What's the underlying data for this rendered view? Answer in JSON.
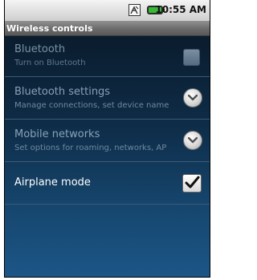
{
  "status_bar": {
    "time": "10:55 AM",
    "icons": [
      "network-icon",
      "battery-icon"
    ]
  },
  "header": {
    "title": "Wireless controls"
  },
  "settings": [
    {
      "title": "Bluetooth",
      "summary": "Turn on Bluetooth",
      "control": "checkbox",
      "checked": false,
      "enabled": false
    },
    {
      "title": "Bluetooth settings",
      "summary": "Manage connections, set device name",
      "control": "chevron-down-icon",
      "enabled": false
    },
    {
      "title": "Mobile networks",
      "summary": "Set options for roaming, networks, AP",
      "control": "chevron-down-icon",
      "enabled": false
    },
    {
      "title": "Airplane mode",
      "control": "checkbox",
      "checked": true,
      "enabled": true
    }
  ],
  "colors": {
    "background_top": "#091623",
    "background_bottom": "#1c5687",
    "header_bar": "#6a6a6a",
    "battery": "#38b936"
  }
}
